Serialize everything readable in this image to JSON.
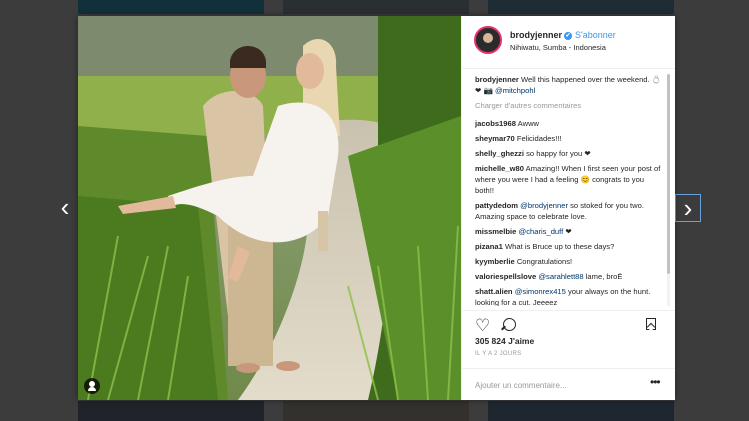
{
  "navigation": {
    "prev_arrow": "‹",
    "next_arrow": "›"
  },
  "post": {
    "username": "brodyjenner",
    "verified_mark": "✔",
    "follow_label": "S'abonner",
    "location": "Nihiwatu, Sumba - Indonesia",
    "load_more_label": "Charger d'autres commentaires",
    "caption": {
      "user": "brodyjenner",
      "text": "Well this happened over the weekend. 💍❤ 📷 ",
      "mention": "@mitchpohl"
    },
    "comments": [
      {
        "user": "jacobs1968",
        "text": "Awww"
      },
      {
        "user": "sheymar70",
        "text": "Felicidades!!!"
      },
      {
        "user": "shelly_ghezzi",
        "text": "so happy for you ❤"
      },
      {
        "user": "michelle_w80",
        "text": "Amazing!! When I first seen your post of where you were I had a feeling 😊 congrats to you both!!"
      },
      {
        "user": "pattydedom",
        "mention": "@brodyjenner",
        "text": " so stoked for you two. Amazing space to celebrate love."
      },
      {
        "user": "missmelbie",
        "mention": "@charis_duff",
        "text": " ❤"
      },
      {
        "user": "pizana1",
        "text": "What is Bruce up to these days?"
      },
      {
        "user": "kyymberlie",
        "text": "Congratulations!"
      },
      {
        "user": "valoriespellslove",
        "mention": "@sarahlett88",
        "text": " lame, broЁ"
      },
      {
        "user": "shatt.alien",
        "mention": "@simonrex415",
        "text": " your always on the hunt. looking for a cut. Jeeeez"
      }
    ],
    "likes_label": "305 824 J'aime",
    "timestamp": "IL Y A 2 JOURS",
    "add_comment_placeholder": "Ajouter un commentaire...",
    "more_glyph": "•••",
    "heart_glyph": "♡"
  },
  "colors": {
    "accent_blue": "#3897f0",
    "mention_blue": "#003569",
    "story_ring": "#e1306c"
  }
}
